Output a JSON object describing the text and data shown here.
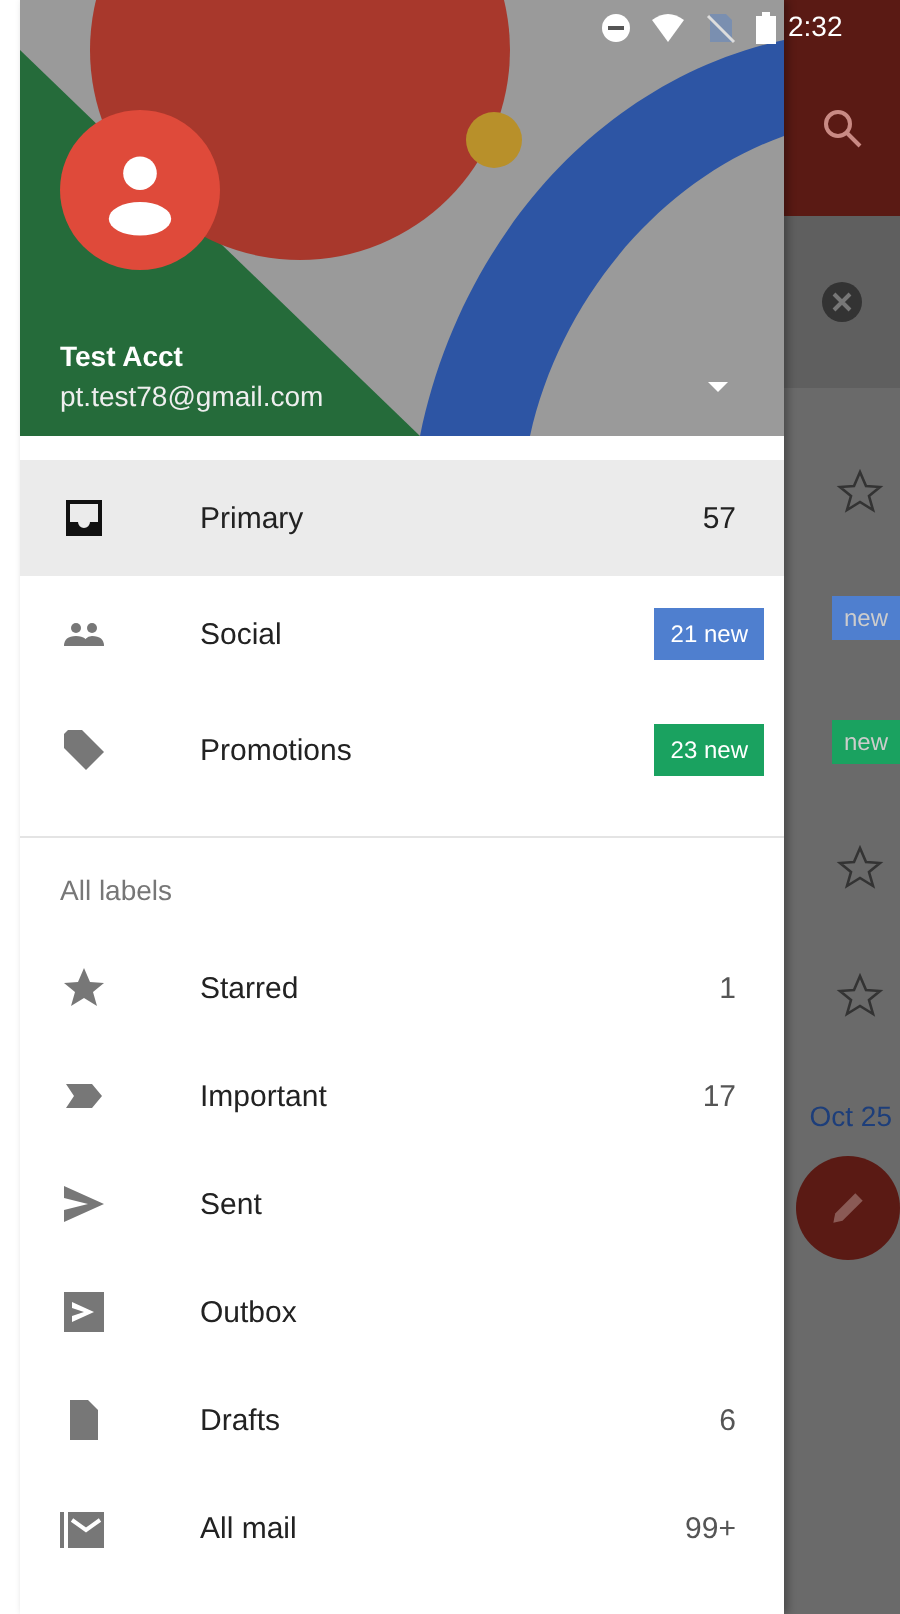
{
  "status_bar": {
    "time": "2:32"
  },
  "account": {
    "name": "Test Acct",
    "email": "pt.test78@gmail.com"
  },
  "categories": [
    {
      "label": "Primary",
      "kind": "inbox",
      "count": "57",
      "selected": true
    },
    {
      "label": "Social",
      "kind": "people",
      "badge": "21 new",
      "color": "#4f7fcf",
      "selected": false
    },
    {
      "label": "Promotions",
      "kind": "tag",
      "badge": "23 new",
      "color": "#1aa260",
      "selected": false
    }
  ],
  "labels_heading": "All labels",
  "labels": [
    {
      "label": "Starred",
      "kind": "star",
      "count": "1"
    },
    {
      "label": "Important",
      "kind": "important",
      "count": "17"
    },
    {
      "label": "Sent",
      "kind": "send"
    },
    {
      "label": "Outbox",
      "kind": "outbox"
    },
    {
      "label": "Drafts",
      "kind": "draft",
      "count": "6"
    },
    {
      "label": "All mail",
      "kind": "allmail",
      "count": "99+"
    }
  ],
  "background": {
    "badges": [
      {
        "text": "new",
        "color": "#4f7fcf"
      },
      {
        "text": "new",
        "color": "#1aa260"
      }
    ],
    "date": "Oct 25"
  }
}
